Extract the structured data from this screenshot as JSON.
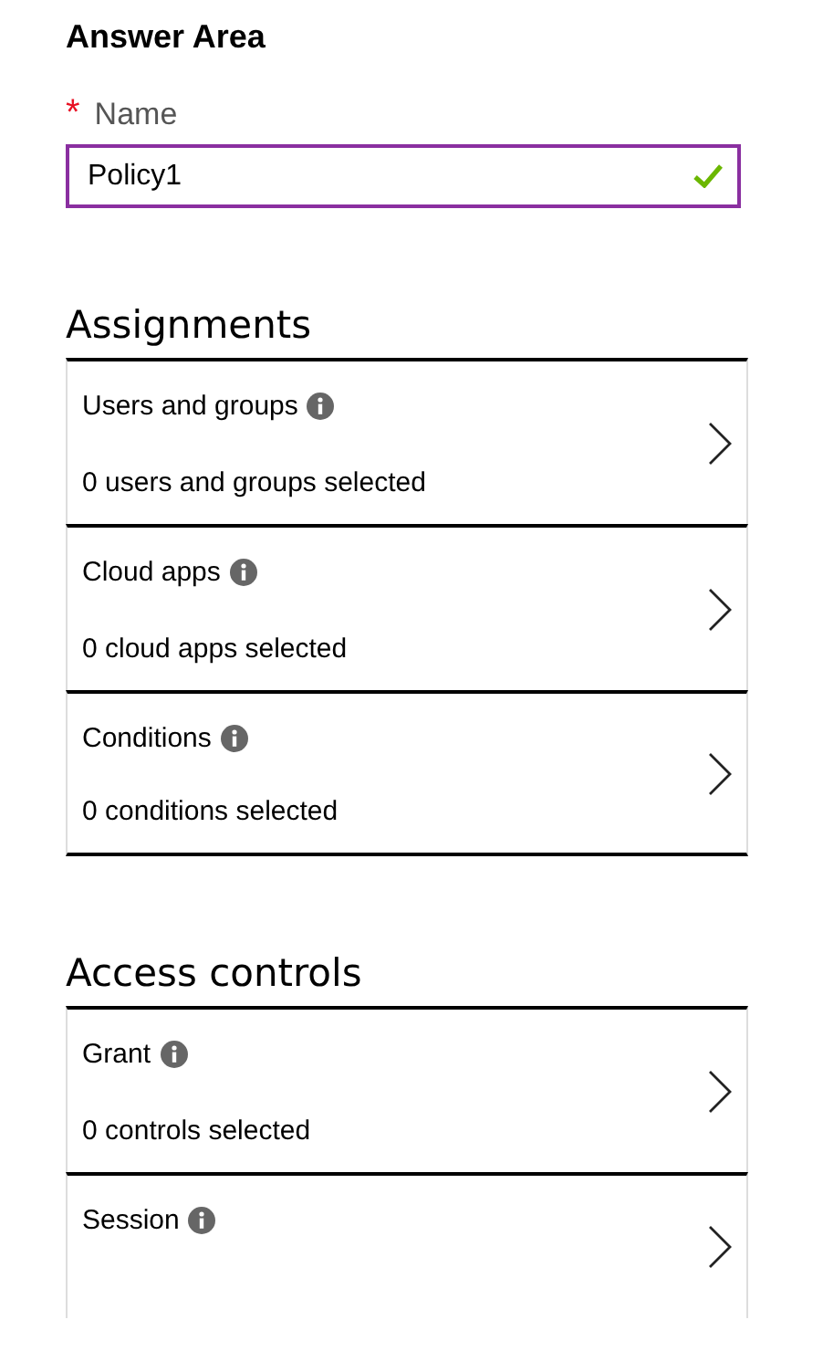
{
  "title": "Answer Area",
  "name_field": {
    "required_mark": "*",
    "label": "Name",
    "value": "Policy1",
    "valid": true
  },
  "sections": [
    {
      "title": "Assignments",
      "items": [
        {
          "title": "Users and groups",
          "summary": "0 users and groups selected"
        },
        {
          "title": "Cloud apps",
          "summary": "0 cloud apps selected"
        },
        {
          "title": "Conditions",
          "summary": "0 conditions selected"
        }
      ]
    },
    {
      "title": "Access controls",
      "items": [
        {
          "title": "Grant",
          "summary": "0 controls selected"
        },
        {
          "title": "Session"
        }
      ]
    }
  ]
}
